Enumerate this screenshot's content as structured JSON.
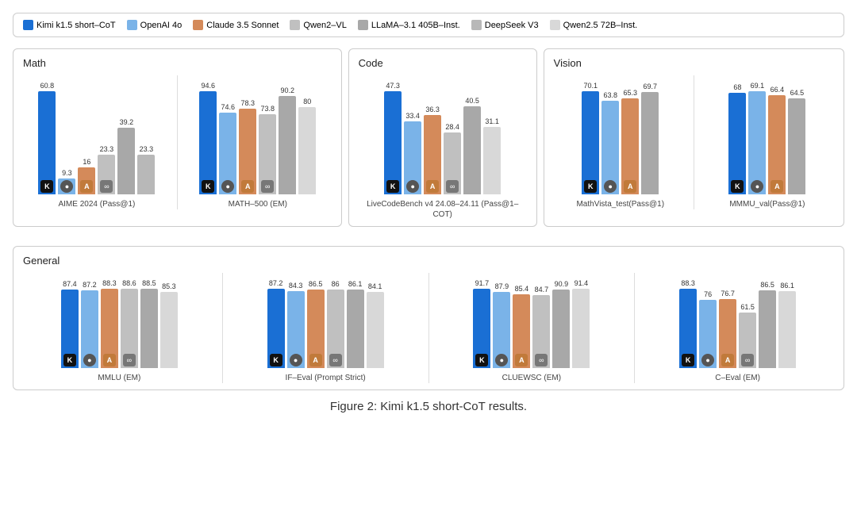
{
  "legend": {
    "items": [
      {
        "label": "Kimi k1.5 short–CoT",
        "color": "#1a6fd4"
      },
      {
        "label": "OpenAI 4o",
        "color": "#7ab3e8"
      },
      {
        "label": "Claude 3.5 Sonnet",
        "color": "#d48a5a"
      },
      {
        "label": "Qwen2–VL",
        "color": "#c0c0c0"
      },
      {
        "label": "LLaMA–3.1 405B–Inst.",
        "color": "#a8a8a8"
      },
      {
        "label": "DeepSeek V3",
        "color": "#b8b8b8"
      },
      {
        "label": "Qwen2.5 72B–Inst.",
        "color": "#d8d8d8"
      }
    ]
  },
  "sections": [
    {
      "title": "Math",
      "charts": [
        {
          "label": "AIME 2024 (Pass@1)",
          "bars": [
            {
              "value": 60.8,
              "color": "#1a6fd4",
              "icon": "K"
            },
            {
              "value": 9.3,
              "color": "#7ab3e8",
              "icon": "⊙"
            },
            {
              "value": 16,
              "color": "#d48a5a",
              "icon": "A"
            },
            {
              "value": 23.3,
              "color": "#c0c0c0",
              "icon": "∞"
            },
            {
              "value": 39.2,
              "color": "#a8a8a8",
              "icon": "⊘"
            },
            {
              "value": 23.3,
              "color": "#b8b8b8",
              "icon": "⊘"
            }
          ]
        },
        {
          "label": "MATH–500 (EM)",
          "bars": [
            {
              "value": 94.6,
              "color": "#1a6fd4",
              "icon": "K"
            },
            {
              "value": 74.6,
              "color": "#7ab3e8",
              "icon": "⊙"
            },
            {
              "value": 78.3,
              "color": "#d48a5a",
              "icon": "A"
            },
            {
              "value": 73.8,
              "color": "#c0c0c0",
              "icon": "∞"
            },
            {
              "value": 90.2,
              "color": "#a8a8a8",
              "icon": "⊘"
            },
            {
              "value": 80,
              "color": "#d8d8d8",
              "icon": "⊘"
            }
          ]
        }
      ]
    },
    {
      "title": "Code",
      "charts": [
        {
          "label": "LiveCodeBench v4 24.08–24.11\n(Pass@1–COT)",
          "bars": [
            {
              "value": 47.3,
              "color": "#1a6fd4",
              "icon": "K"
            },
            {
              "value": 33.4,
              "color": "#7ab3e8",
              "icon": "⊙"
            },
            {
              "value": 36.3,
              "color": "#d48a5a",
              "icon": "A"
            },
            {
              "value": 28.4,
              "color": "#c0c0c0",
              "icon": "∞"
            },
            {
              "value": 40.5,
              "color": "#a8a8a8",
              "icon": "⊘"
            },
            {
              "value": 31.1,
              "color": "#d8d8d8",
              "icon": "⊘"
            }
          ]
        }
      ]
    },
    {
      "title": "Vision",
      "charts": [
        {
          "label": "MathVista_test(Pass@1)",
          "bars": [
            {
              "value": 70.1,
              "color": "#1a6fd4",
              "icon": "K"
            },
            {
              "value": 63.8,
              "color": "#7ab3e8",
              "icon": "⊙"
            },
            {
              "value": 65.3,
              "color": "#d48a5a",
              "icon": "A"
            },
            {
              "value": 69.7,
              "color": "#a8a8a8",
              "icon": "⊘"
            }
          ]
        },
        {
          "label": "MMMU_val(Pass@1)",
          "bars": [
            {
              "value": 68,
              "color": "#1a6fd4",
              "icon": "K"
            },
            {
              "value": 69.1,
              "color": "#7ab3e8",
              "icon": "⊙"
            },
            {
              "value": 66.4,
              "color": "#d48a5a",
              "icon": "A"
            },
            {
              "value": 64.5,
              "color": "#a8a8a8",
              "icon": "⊘"
            }
          ]
        }
      ]
    }
  ],
  "section_general": {
    "title": "General",
    "charts": [
      {
        "label": "MMLU (EM)",
        "bars": [
          {
            "value": 87.4,
            "color": "#1a6fd4",
            "icon": "K"
          },
          {
            "value": 87.2,
            "color": "#7ab3e8",
            "icon": "⊙"
          },
          {
            "value": 88.3,
            "color": "#d48a5a",
            "icon": "A"
          },
          {
            "value": 88.6,
            "color": "#c0c0c0",
            "icon": "∞"
          },
          {
            "value": 88.5,
            "color": "#a8a8a8",
            "icon": "⊘"
          },
          {
            "value": 85.3,
            "color": "#d8d8d8",
            "icon": "⊘"
          }
        ]
      },
      {
        "label": "IF–Eval (Prompt Strict)",
        "bars": [
          {
            "value": 87.2,
            "color": "#1a6fd4",
            "icon": "K"
          },
          {
            "value": 84.3,
            "color": "#7ab3e8",
            "icon": "⊙"
          },
          {
            "value": 86.5,
            "color": "#d48a5a",
            "icon": "A"
          },
          {
            "value": 86,
            "color": "#c0c0c0",
            "icon": "∞"
          },
          {
            "value": 86.1,
            "color": "#a8a8a8",
            "icon": "⊘"
          },
          {
            "value": 84.1,
            "color": "#d8d8d8",
            "icon": "⊘"
          }
        ]
      },
      {
        "label": "CLUEWSC (EM)",
        "bars": [
          {
            "value": 91.7,
            "color": "#1a6fd4",
            "icon": "K"
          },
          {
            "value": 87.9,
            "color": "#7ab3e8",
            "icon": "⊙"
          },
          {
            "value": 85.4,
            "color": "#d48a5a",
            "icon": "A"
          },
          {
            "value": 84.7,
            "color": "#c0c0c0",
            "icon": "∞"
          },
          {
            "value": 90.9,
            "color": "#a8a8a8",
            "icon": "⊘"
          },
          {
            "value": 91.4,
            "color": "#d8d8d8",
            "icon": "⊘"
          }
        ]
      },
      {
        "label": "C–Eval (EM)",
        "bars": [
          {
            "value": 88.3,
            "color": "#1a6fd4",
            "icon": "K"
          },
          {
            "value": 76,
            "color": "#7ab3e8",
            "icon": "⊙"
          },
          {
            "value": 76.7,
            "color": "#d48a5a",
            "icon": "A"
          },
          {
            "value": 61.5,
            "color": "#c0c0c0",
            "icon": "∞"
          },
          {
            "value": 86.5,
            "color": "#a8a8a8",
            "icon": "⊘"
          },
          {
            "value": 86.1,
            "color": "#d8d8d8",
            "icon": "⊘"
          }
        ]
      }
    ]
  },
  "caption": "Figure 2: Kimi k1.5 short-CoT results."
}
